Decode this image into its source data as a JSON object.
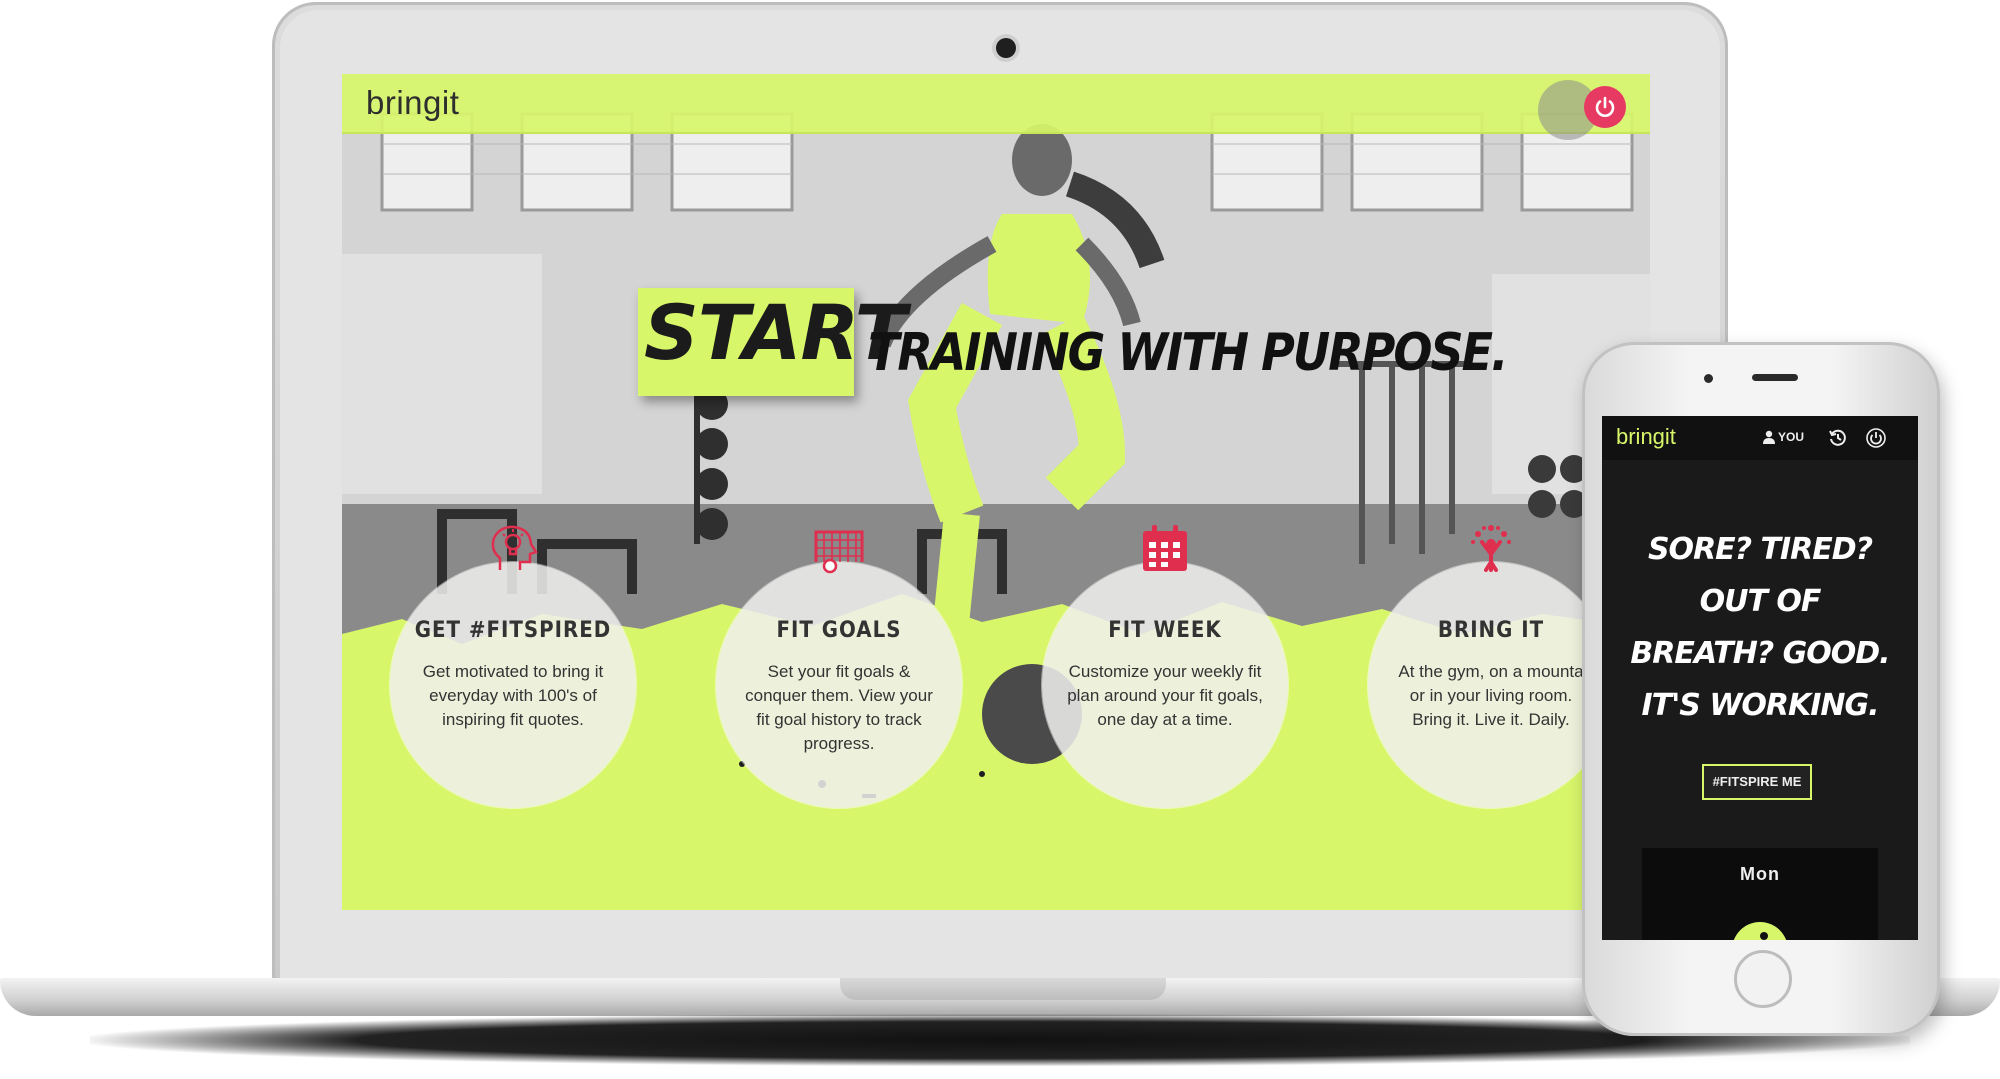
{
  "colors": {
    "accent": "#d8f66a",
    "power_button": "#e63a63",
    "icon_red": "#e02e4f",
    "phone_screen_bg": "#1a1a1a"
  },
  "laptop": {
    "logo": "bringit",
    "power_icon": "power-icon",
    "headline_highlight": "START",
    "headline_rest": "TRAINING WITH PURPOSE.",
    "features": [
      {
        "icon": "head-lightbulb-icon",
        "title": "GET #FITSPIRED",
        "text": "Get motivated to bring it everyday with 100's of inspiring fit quotes."
      },
      {
        "icon": "soccer-goal-icon",
        "title": "FIT GOALS",
        "text": "Set your fit goals & conquer them. View your fit goal history to track progress."
      },
      {
        "icon": "calendar-icon",
        "title": "FIT WEEK",
        "text": "Customize your weekly fit plan around your fit goals, one day at a time."
      },
      {
        "icon": "tree-person-icon",
        "title": "BRING IT",
        "text": "At the gym, on a mounta or in your living room. Bring it. Live it. Daily."
      }
    ]
  },
  "phone": {
    "logo": "bringit",
    "user_label": "YOU",
    "icons": [
      "user-icon",
      "history-icon",
      "power-icon"
    ],
    "quote_lines": [
      "SORE? TIRED?",
      "OUT OF",
      "BREATH? GOOD.",
      "IT'S WORKING."
    ],
    "button_label": "#FITSPIRE ME",
    "day_label": "Mon",
    "activity_icon": "running-person-icon"
  }
}
